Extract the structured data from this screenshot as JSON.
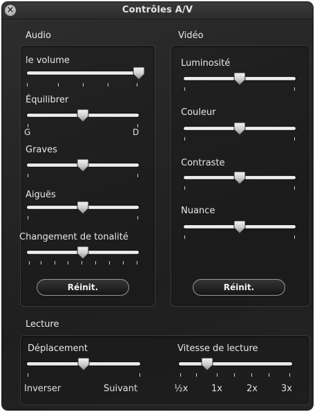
{
  "window": {
    "title": "Contrôles A/V"
  },
  "audio": {
    "section_label": "Audio",
    "sliders": [
      {
        "label": "le volume",
        "value": 1.0
      },
      {
        "label": "Équilibrer",
        "value": 0.5,
        "min_label": "G",
        "max_label": "D"
      },
      {
        "label": "Graves",
        "value": 0.5
      },
      {
        "label": "Aiguës",
        "value": 0.5
      },
      {
        "label": "Changement de tonalité",
        "value": 0.5
      }
    ],
    "reset_label": "Réinit."
  },
  "video": {
    "section_label": "Vidéo",
    "sliders": [
      {
        "label": "Luminosité",
        "value": 0.5
      },
      {
        "label": "Couleur",
        "value": 0.5
      },
      {
        "label": "Contraste",
        "value": 0.5
      },
      {
        "label": "Nuance",
        "value": 0.5
      }
    ],
    "reset_label": "Réinit."
  },
  "playback": {
    "section_label": "Lecture",
    "jog": {
      "label": "Déplacement",
      "value": 0.5,
      "min_label": "Inverser",
      "max_label": "Suivant"
    },
    "speed": {
      "label": "Vitesse de lecture",
      "value": 0.25,
      "tick_labels": [
        "½x",
        "1x",
        "2x",
        "3x"
      ]
    }
  }
}
